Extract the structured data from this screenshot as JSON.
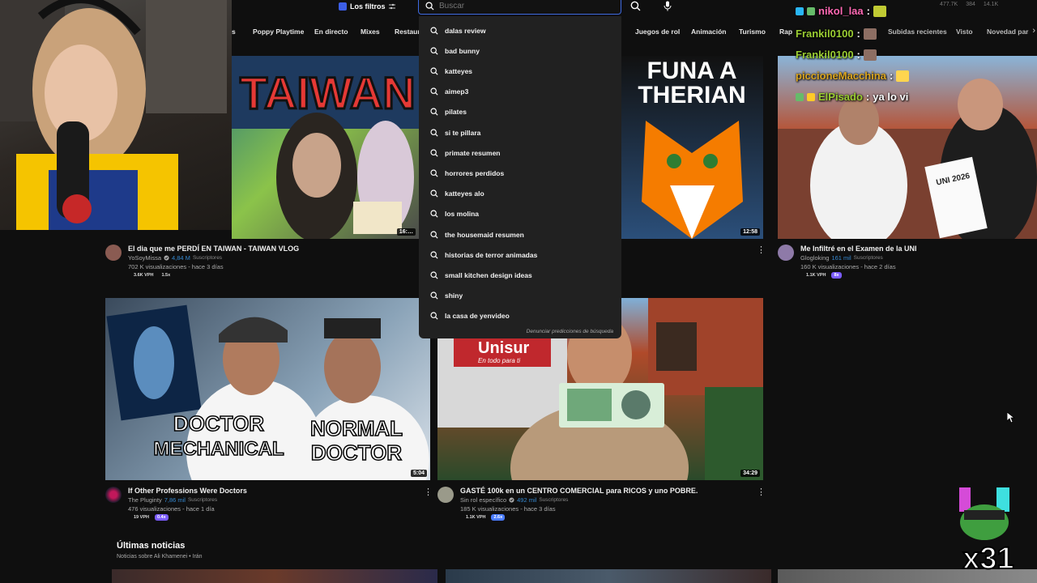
{
  "header": {
    "filters_label": "Los filtros",
    "search_placeholder": "Buscar",
    "overlay_stats": [
      "477.7K",
      "384",
      "14.1K"
    ]
  },
  "chips": [
    "s",
    "Poppy Playtime",
    "En directo",
    "Mixes",
    "Restaurantes",
    "Juegos de rol",
    "Animación",
    "Turismo",
    "Rap",
    "Subidas recientes",
    "Visto",
    "Novedad para ti"
  ],
  "suggestions": [
    "dalas review",
    "bad bunny",
    "katteyes",
    "aimep3",
    "pilates",
    "si te pillara",
    "primate resumen",
    "horrores perdidos",
    "katteyes alo",
    "los molina",
    "the housemaid resumen",
    "historias de terror animadas",
    "small kitchen design ideas",
    "shiny",
    "la casa de yenvideo"
  ],
  "report_predictions": "Denunciar predicciones de búsqueda",
  "chat": [
    {
      "user": "nikol_laa",
      "color": "#ff69b4",
      "text": ""
    },
    {
      "user": "Frankil0100",
      "color": "#9acd32",
      "text": ""
    },
    {
      "user": "Frankil0100",
      "color": "#9acd32",
      "text": ""
    },
    {
      "user": "piccioneMacchina",
      "color": "#daa520",
      "text": ""
    },
    {
      "user": "ElPisado",
      "color": "#9acd32",
      "text": "ya lo vi"
    }
  ],
  "videos": [
    {
      "title": "El dia que me PERDÍ EN TAIWAN - TAIWAN VLOG",
      "channel": "YoSoyMissa",
      "subs": "4,84 M",
      "subs_label": "Suscriptores",
      "stats": "702 K visualizaciones - hace 3 días",
      "vph": "3.6K VPH",
      "multiplier": "1.5x",
      "duration": "16:…",
      "thumb_text": "TAIWAN"
    },
    {
      "title": "",
      "channel": "",
      "subs": "",
      "subs_label": "",
      "stats": "",
      "vph": "",
      "multiplier": "",
      "duration": "12:58",
      "thumb_text": "FUNA A THERIAN"
    },
    {
      "title": "Me Infiltré en el Examen de la UNI",
      "channel": "Glogloking",
      "subs": "161 mil",
      "subs_label": "Suscriptores",
      "stats": "160 K visualizaciones - hace 2 días",
      "vph": "1.1K VPH",
      "multiplier": "8x",
      "duration": "",
      "thumb_text": "UNI 2026"
    },
    {
      "title": "If Other Professions Were Doctors",
      "channel": "The Pluginty",
      "subs": "7,86 mil",
      "subs_label": "Suscriptores",
      "stats": "476 visualizaciones - hace 1 día",
      "vph": "19 VPH",
      "multiplier": "0.4x",
      "duration": "5:04",
      "thumb_text_a": "DOCTOR MECHANICAL",
      "thumb_text_b": "NORMAL DOCTOR"
    },
    {
      "title": "GASTÉ 100k en un CENTRO COMERCIAL para RICOS y uno POBRE.",
      "channel": "Sin rol específico",
      "subs": "492 mil",
      "subs_label": "Suscriptores",
      "stats": "185 K visualizaciones - hace 3 días",
      "vph": "1.1K VPH",
      "multiplier": "2.6x",
      "duration": "34:29",
      "thumb_text_a": "Unisur",
      "thumb_text_b": "En todo para ti"
    }
  ],
  "news": {
    "title": "Últimas noticias",
    "subtitle": "Noticias sobre Ali Khamenei • Irán"
  },
  "overlay_multiplier": "x31"
}
